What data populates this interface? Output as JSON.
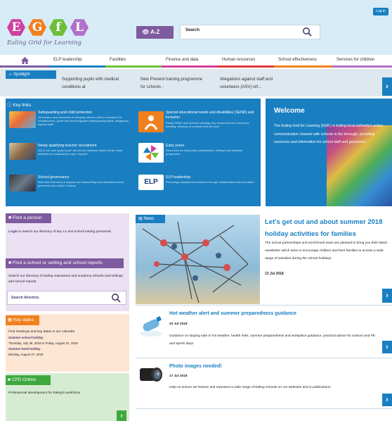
{
  "brand": {
    "logo_letters": [
      "E",
      "G",
      "f",
      "L"
    ],
    "logo_colors": [
      "#d0409f",
      "#f0801e",
      "#6dbf3a",
      "#b070c8"
    ],
    "tagline": "Ealing Grid for Learning"
  },
  "header": {
    "login_label": "Log in",
    "az_label": "A-Z",
    "search_label": "Search"
  },
  "nav": {
    "home_icon": "home-icon",
    "items": [
      {
        "label": "ELP leadership",
        "color": "#1a7fc1"
      },
      {
        "label": "Facilities",
        "color": "#6dbf3a"
      },
      {
        "label": "Finance and data",
        "color": "#d0409f"
      },
      {
        "label": "Human resources",
        "color": "#e03a3a"
      },
      {
        "label": "School effectiveness",
        "color": "#f0801e"
      },
      {
        "label": "Services for children",
        "color": "#b070c8"
      }
    ]
  },
  "spotlight": {
    "label": "Spotlight",
    "items": [
      "Supporting pupils with medical conditions at",
      "New Prevent training programme for schools -",
      "Allegations against staff and volunteers (ASV) ref..."
    ]
  },
  "key_links": {
    "label": "Key links",
    "items": [
      {
        "title": "Safeguarding and child protection",
        "desc": "Information and resources on keeping children safe in education for headteachers, governors and designated safeguarding leads, allegations against staff."
      },
      {
        "title": "Special educational needs and disabilities (SEND) and inclusion",
        "desc": "Ealing SEND and inclusion strategy, key documents and resources, banding, directory of contacts and services."
      },
      {
        "title": "Newly qualifying teacher recruitment",
        "desc": "NQTs can now apply to join the secure database which will be made available to headteachers upon request."
      },
      {
        "title": "Early years",
        "desc": "Resources for early years practitioners, settings and childcare programme."
      },
      {
        "title": "School governance",
        "desc": "Web area that aims to support our hardworking and dedicated school governors and clerks in Ealing."
      },
      {
        "title": "ELP leadership",
        "desc": "Promoting educational excellence through collaboration and innovation."
      }
    ],
    "elp_badge": "ELP"
  },
  "welcome": {
    "title": "Welcome",
    "text": "The Ealing Grid for Learning (EGfL) is Ealing local authority's online communication channel with schools in the borough, providing resources and information for school staff and governors."
  },
  "find_person": {
    "label": "Find a person",
    "link": "Login",
    "text": " to search our directory of key LA and school setting personnel."
  },
  "find_school": {
    "label": "Find a school or setting and school reports",
    "text": "Search our directory of Ealing maintained and academy schools and settings and school reports",
    "search_placeholder": "Search directory"
  },
  "key_dates": {
    "label": "Key dates",
    "intro": "Find meetings and key dates in our calendar",
    "events": [
      {
        "name": "Summer school holiday",
        "when": "Thursday, July 26, 2018 to Friday, August 31, 2018"
      },
      {
        "name": "Summer bank holiday",
        "when": "Monday, August 27, 2018"
      }
    ]
  },
  "cpd": {
    "label": "CPD Online",
    "text": "Professional development for Ealing's workforce"
  },
  "news": {
    "label": "News",
    "lead": {
      "title": "Let's get out and about summer 2018 holiday activities for families",
      "text": "The school partnerships and enrichment team are pleased to bring you their latest newsletter which aims to encourage children and their families to access a wide range of activities during the school holidays.",
      "date": "13 Jul 2018"
    },
    "items": [
      {
        "title": "Hot weather alert and summer preparedness guidance",
        "date": "23 Jul 2018",
        "text": "Guidance on staying safe in hot weather: health risks, summer preparedness and workplace guidance, practical advice for indoors and PE and sports days."
      },
      {
        "title": "Photo images needed!",
        "date": "17 Jul 2018",
        "text": "Help us ensure we feature and represent a wide range of Ealing schools on our websites and in publications."
      }
    ]
  }
}
